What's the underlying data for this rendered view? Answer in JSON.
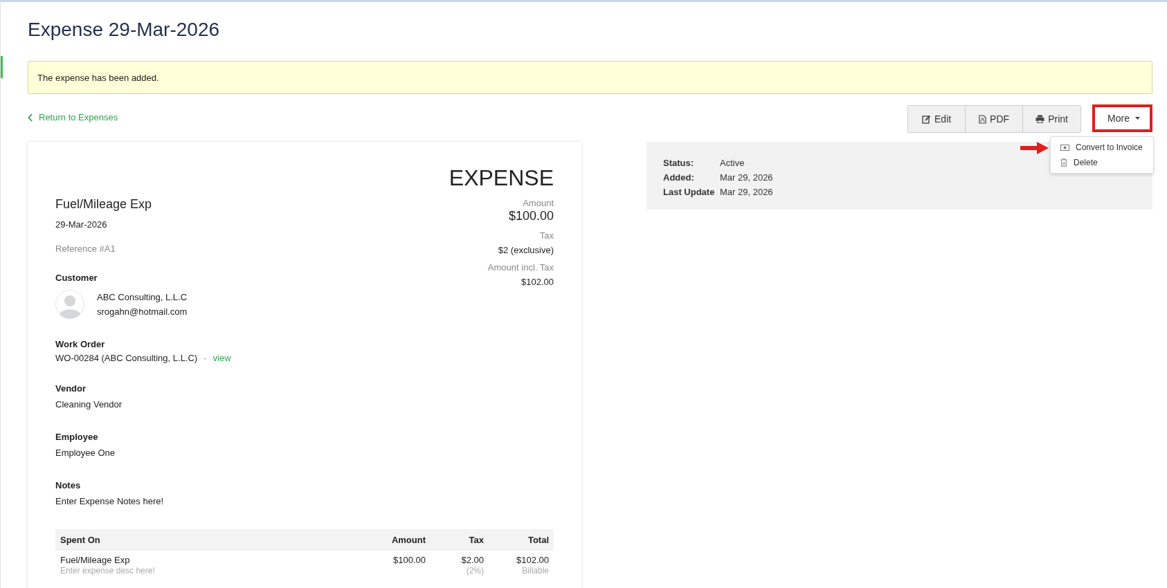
{
  "page_title": "Expense 29-Mar-2026",
  "alert": "The expense has been added.",
  "back_link": "Return to Expenses",
  "toolbar": [
    {
      "kind": "edit",
      "label": "Edit"
    },
    {
      "kind": "pdf",
      "label": "PDF"
    },
    {
      "kind": "print",
      "label": "Print"
    }
  ],
  "more_button": {
    "label": "More",
    "highlighted": true
  },
  "more_menu": [
    {
      "kind": "convert",
      "label": "Convert to Invoice",
      "pointed": true
    },
    {
      "kind": "delete",
      "label": "Delete",
      "pointed": false
    }
  ],
  "document": {
    "heading": "EXPENSE",
    "item": "Fuel/Mileage Exp",
    "date": "29-Mar-2026",
    "reference": "Reference #A1",
    "totals": [
      {
        "label": "Amount",
        "value": "$100.00",
        "kind": "large"
      },
      {
        "label": "Tax",
        "value": "$2 (exclusive)",
        "kind": "normal"
      },
      {
        "label": "Amount incl. Tax",
        "value": "$102.00",
        "kind": "normal"
      }
    ],
    "customer": {
      "label": "Customer",
      "name": "ABC Consulting, L.L.C",
      "email": "srogahn@hotmail.com"
    },
    "work_order": {
      "label": "Work Order",
      "value": "WO-00284 (ABC Consulting, L.L.C)",
      "separator": "·",
      "link": "view"
    },
    "fields": [
      {
        "label": "Vendor",
        "value": "Cleaning Vendor"
      },
      {
        "label": "Employee",
        "value": "Employee One"
      },
      {
        "label": "Notes",
        "value": "Enter Expense Notes here!"
      }
    ],
    "table": {
      "columns": [
        "Spent On",
        "Amount",
        "Tax",
        "Total"
      ],
      "rows": [
        {
          "cells": [
            "Fuel/Mileage Exp",
            "$100.00",
            "$2.00",
            "$102.00"
          ],
          "subcells": [
            "Enter expense desc here!",
            "",
            "(2%)",
            "Billable"
          ]
        }
      ]
    }
  },
  "status": [
    {
      "label": "Status:",
      "value": "Active"
    },
    {
      "label": "Added:",
      "value": "Mar 29, 2026"
    },
    {
      "label": "Last Update",
      "value": "Mar 29, 2026"
    }
  ]
}
